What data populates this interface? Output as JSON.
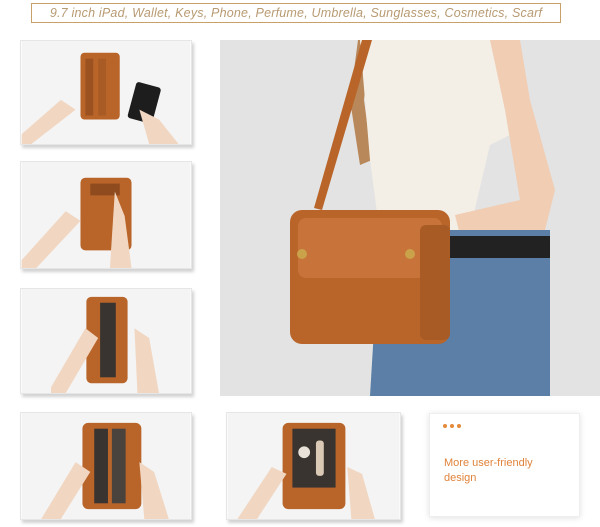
{
  "banner": {
    "text": "9.7 inch iPad, Wallet, Keys, Phone, Perfume, Umbrella, Sunglasses, Cosmetics, Scarf"
  },
  "feature_card": {
    "text": "More user-friendly design"
  },
  "colors": {
    "accent": "#e0833a",
    "leather": "#b9652a",
    "banner_border": "#c8a06a"
  }
}
